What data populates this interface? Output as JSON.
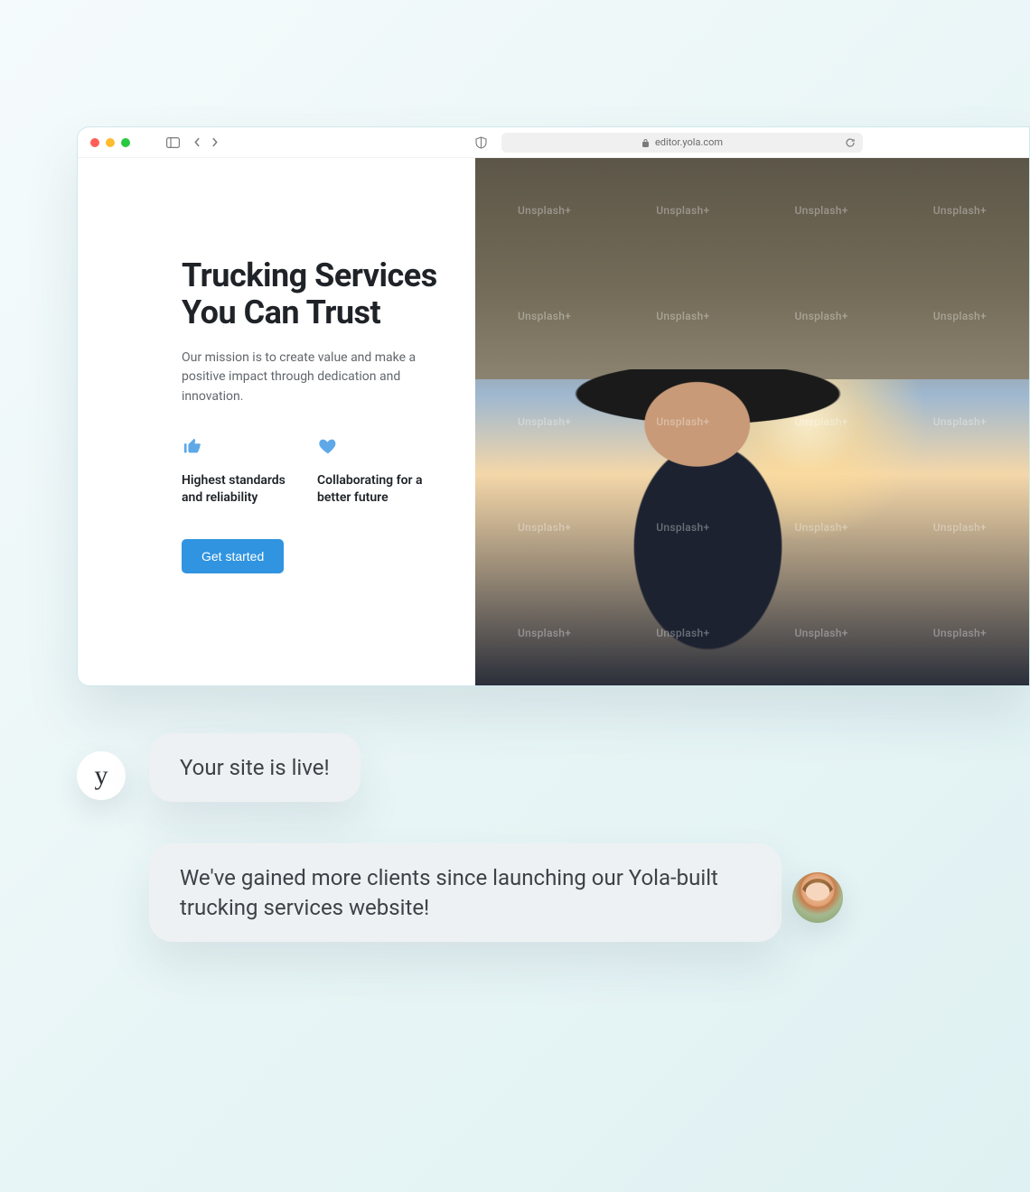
{
  "browser": {
    "url_display": "editor.yola.com"
  },
  "hero": {
    "title": "Trucking Services You Can Trust",
    "subtitle": "Our mission is to create value and make a positive impact through dedication and innovation.",
    "cta_label": "Get started",
    "image_watermark": "Unsplash+"
  },
  "features": [
    {
      "icon": "thumbs-up-icon",
      "title": "Highest standards and reliability"
    },
    {
      "icon": "heart-icon",
      "title": "Collaborating for a better future"
    }
  ],
  "chat": {
    "brand_initial": "y",
    "messages": [
      {
        "from": "yola",
        "text": "Your site is live!"
      },
      {
        "from": "user",
        "text": "We've gained more clients since launching our Yola-built trucking services website!"
      }
    ]
  }
}
